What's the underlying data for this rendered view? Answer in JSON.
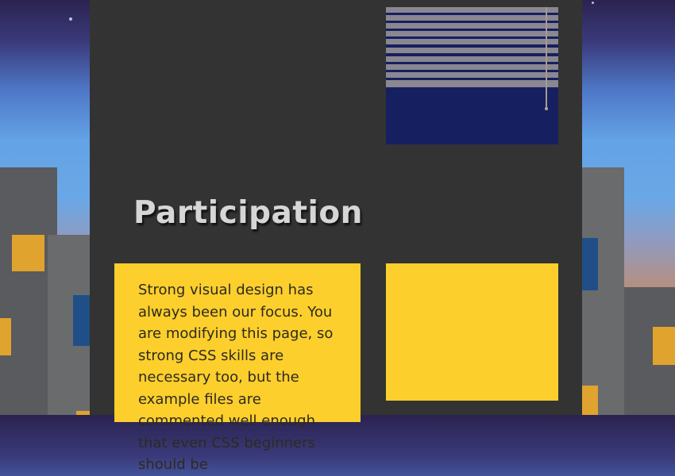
{
  "section": {
    "title": "Participation",
    "body": "Strong visual design has always been our focus. You are modifying this page, so strong CSS skills are necessary too, but the example files are commented well enough that even CSS beginners should be"
  },
  "colors": {
    "panel": "#333333",
    "card": "#fccf2c",
    "blind_window": "#162060",
    "slats": "#8a8791",
    "title": "#d6d6d6"
  }
}
